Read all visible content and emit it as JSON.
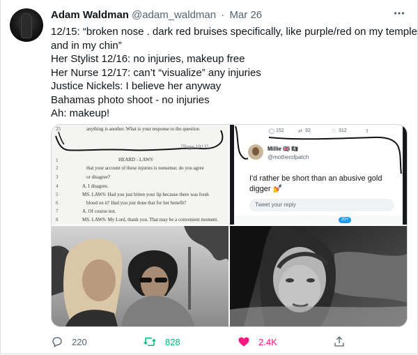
{
  "tweet": {
    "author_name": "Adam Waldman",
    "handle": "@adam_waldman",
    "separator": "·",
    "date": "Mar 26",
    "lines": [
      "12/15: “broken nose . dark red bruises specifically, like purple/red on my temples",
      "and in my chin”",
      "Her Stylist 12/16: no injuries, makeup free",
      "Her Nurse 12/17: can’t “visualize” any injuries",
      "Justice Nickels: I believe her anyway",
      "Bahamas photo shoot - no injuries",
      "Ah: makeup!"
    ],
    "more_icon": "ellipsis-icon"
  },
  "media": {
    "transcript": {
      "top_line_number": "25",
      "top_line": "anything is another.  What is your response to the question",
      "page_label": "[Page 1913]",
      "heading": "HEARD - LAWS",
      "lines": [
        {
          "n": "1",
          "t": ""
        },
        {
          "n": "2",
          "t": "that your account of these injuries is nonsense; do you agree"
        },
        {
          "n": "3",
          "t": "or disagree?"
        },
        {
          "n": "4",
          "t": "A.  I disagree."
        },
        {
          "n": "5",
          "t": "MS. LAWS:  Had you just bitten your lip because there was fresh"
        },
        {
          "n": "6",
          "t": "blood on it?  Had you just done that for her benefit?"
        },
        {
          "n": "7",
          "t": "A.  Of course not."
        },
        {
          "n": "8",
          "t": "MS. LAWS:  My Lord, thank you.  That may be a convenient moment."
        }
      ]
    },
    "screenshot": {
      "metric_reply": "152",
      "metric_retweet": "92",
      "metric_like": "312",
      "user_name": "Millie 🇬🇧 🏴‍☠️",
      "user_handle": "@motherofpatch",
      "text_line1": "I'd rather be short than an abusive gold",
      "text_line2": "digger 💅",
      "reply_placeholder": "Tweet your reply",
      "badge": "20+"
    }
  },
  "actions": {
    "reply_count": "220",
    "retweet_count": "828",
    "like_count": "2.4K",
    "reply_icon": "reply-icon",
    "retweet_icon": "retweet-icon",
    "like_icon": "heart-icon",
    "share_icon": "share-icon"
  },
  "colors": {
    "text": "#0f1419",
    "secondary": "#536471",
    "retweet_green": "#00ba7c",
    "like_pink": "#f91880",
    "border": "#cfd9de"
  }
}
